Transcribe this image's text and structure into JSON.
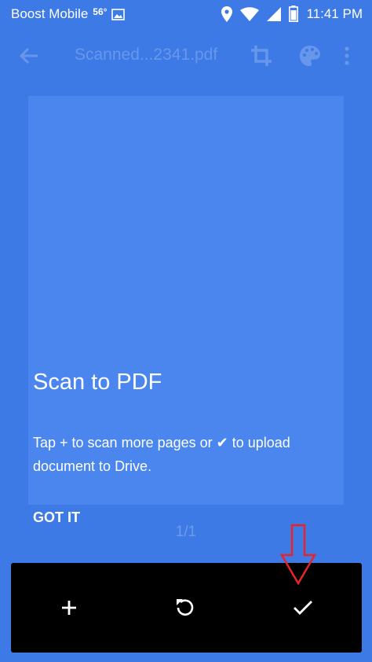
{
  "status_bar": {
    "carrier": "Boost Mobile",
    "temperature": "56°",
    "time": "11:41 PM"
  },
  "toolbar": {
    "document_title": "Scanned...2341.pdf",
    "back_icon": "arrow-back-icon",
    "crop_icon": "crop-icon",
    "palette_icon": "palette-icon",
    "more_icon": "more-vert-icon"
  },
  "tutorial": {
    "title": "Scan to PDF",
    "body": "Tap + to scan more pages or ✔ to upload document to Drive.",
    "dismiss_label": "GOT IT"
  },
  "page_counter": "1/1",
  "bottom_bar": {
    "add_icon": "plus-icon",
    "retake_icon": "refresh-icon",
    "done_icon": "check-icon"
  },
  "colors": {
    "background": "#3d7ae6",
    "page_preview": "#4a86ee",
    "bottom_bar": "#000000",
    "hint_arrow": "#e8242a"
  }
}
